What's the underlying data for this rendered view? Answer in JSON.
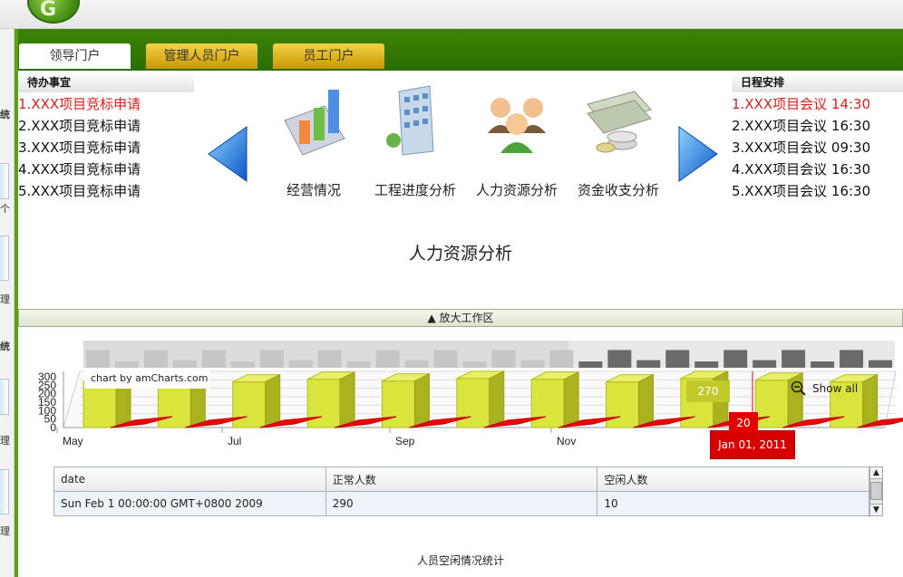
{
  "header": {
    "logo_text": "G"
  },
  "left_strip": {
    "labels": [
      "统",
      "统"
    ],
    "small": [
      "个",
      "理",
      "理",
      "理"
    ]
  },
  "tabs": [
    {
      "label": "领导门户",
      "active": true
    },
    {
      "label": "管理人员门户",
      "active": false
    },
    {
      "label": "员工门户",
      "active": false
    }
  ],
  "todo": {
    "title": "待办事宜",
    "items": [
      "1.XXX项目竞标申请",
      "2.XXX项目竞标申请",
      "3.XXX项目竞标申请",
      "4.XXX项目竞标申请",
      "5.XXX项目竞标申请"
    ]
  },
  "schedule": {
    "title": "日程安排",
    "items": [
      "1.XXX项目会议 14:30",
      "2.XXX项目会议 16:30",
      "3.XXX项目会议 09:30",
      "4.XXX项目会议 16:30",
      "5.XXX项目会议 16:30"
    ]
  },
  "carousel": {
    "items": [
      {
        "label": "经营情况",
        "icon": "bar-chart-icon"
      },
      {
        "label": "工程进度分析",
        "icon": "building-icon"
      },
      {
        "label": "人力资源分析",
        "icon": "people-icon"
      },
      {
        "label": "资金收支分析",
        "icon": "money-icon"
      }
    ]
  },
  "section_title": "人力资源分析",
  "expand_bar": "▲ 放大工作区",
  "chart": {
    "credit": "chart by amCharts.com",
    "show_all": "Show all",
    "balloon_series1": "270",
    "balloon_series2": "20",
    "balloon_date": "Jan 01, 2011"
  },
  "chart_data": {
    "type": "bar",
    "y_ticks": [
      "300",
      "250",
      "200",
      "150",
      "100",
      "50",
      "0"
    ],
    "x_ticks": [
      "May",
      "Jul",
      "Sep",
      "Nov"
    ],
    "ylim": [
      0,
      300
    ],
    "series": [
      {
        "name": "正常人数",
        "values": [
          270,
          280,
          270,
          285,
          275,
          290,
          285,
          270,
          290,
          280,
          270
        ]
      },
      {
        "name": "空闲人数",
        "values": [
          20,
          15,
          20,
          10,
          15,
          10,
          15,
          20,
          10,
          15,
          20
        ]
      }
    ],
    "scrollbar_bars": [
      0.7,
      0.25,
      0.7,
      0.3,
      0.7,
      0.25,
      0.7,
      0.3,
      0.7,
      0.25,
      0.7,
      0.3,
      0.7,
      0.25,
      0.7,
      0.3,
      0.7,
      0.25,
      0.7,
      0.3,
      0.7,
      0.25,
      0.7,
      0.3,
      0.7,
      0.25,
      0.7,
      0.3
    ],
    "colors": {
      "series1": "#d9e43c",
      "series2": "#f00000",
      "scroll_light": "#c6c6c6",
      "scroll_dark": "#6a6a6a"
    }
  },
  "table": {
    "headers": [
      "date",
      "正常人数",
      "空闲人数"
    ],
    "rows": [
      [
        "Sun Feb 1 00:00:00 GMT+0800 2009",
        "290",
        "10"
      ]
    ]
  },
  "footer_caption": "人员空闲情况统计",
  "colors": {
    "green_band": "#3b8406",
    "tab_gold": "#f2d34a",
    "highlight_red": "#d62020"
  }
}
